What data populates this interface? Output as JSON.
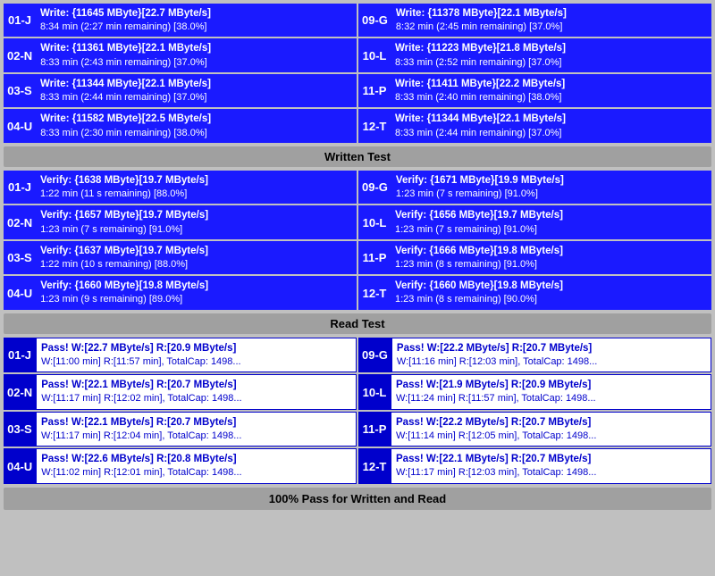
{
  "sections": {
    "write": {
      "header": "Written Test",
      "left": [
        {
          "id": "01-J",
          "line1": "Write: {11645 MByte}[22.7 MByte/s]",
          "line2": "8:34 min (2:27 min remaining)  [38.0%]"
        },
        {
          "id": "02-N",
          "line1": "Write: {11361 MByte}[22.1 MByte/s]",
          "line2": "8:33 min (2:43 min remaining)  [37.0%]"
        },
        {
          "id": "03-S",
          "line1": "Write: {11344 MByte}[22.1 MByte/s]",
          "line2": "8:33 min (2:44 min remaining)  [37.0%]"
        },
        {
          "id": "04-U",
          "line1": "Write: {11582 MByte}[22.5 MByte/s]",
          "line2": "8:33 min (2:30 min remaining)  [38.0%]"
        }
      ],
      "right": [
        {
          "id": "09-G",
          "line1": "Write: {11378 MByte}[22.1 MByte/s]",
          "line2": "8:32 min (2:45 min remaining)  [37.0%]"
        },
        {
          "id": "10-L",
          "line1": "Write: {11223 MByte}[21.8 MByte/s]",
          "line2": "8:33 min (2:52 min remaining)  [37.0%]"
        },
        {
          "id": "11-P",
          "line1": "Write: {11411 MByte}[22.2 MByte/s]",
          "line2": "8:33 min (2:40 min remaining)  [38.0%]"
        },
        {
          "id": "12-T",
          "line1": "Write: {11344 MByte}[22.1 MByte/s]",
          "line2": "8:33 min (2:44 min remaining)  [37.0%]"
        }
      ]
    },
    "verify": {
      "header": "Written Test",
      "left": [
        {
          "id": "01-J",
          "line1": "Verify: {1638 MByte}[19.7 MByte/s]",
          "line2": "1:22 min (11 s remaining)   [88.0%]"
        },
        {
          "id": "02-N",
          "line1": "Verify: {1657 MByte}[19.7 MByte/s]",
          "line2": "1:23 min (7 s remaining)   [91.0%]"
        },
        {
          "id": "03-S",
          "line1": "Verify: {1637 MByte}[19.7 MByte/s]",
          "line2": "1:22 min (10 s remaining)   [88.0%]"
        },
        {
          "id": "04-U",
          "line1": "Verify: {1660 MByte}[19.8 MByte/s]",
          "line2": "1:23 min (9 s remaining)   [89.0%]"
        }
      ],
      "right": [
        {
          "id": "09-G",
          "line1": "Verify: {1671 MByte}[19.9 MByte/s]",
          "line2": "1:23 min (7 s remaining)   [91.0%]"
        },
        {
          "id": "10-L",
          "line1": "Verify: {1656 MByte}[19.7 MByte/s]",
          "line2": "1:23 min (7 s remaining)   [91.0%]"
        },
        {
          "id": "11-P",
          "line1": "Verify: {1666 MByte}[19.8 MByte/s]",
          "line2": "1:23 min (8 s remaining)   [91.0%]"
        },
        {
          "id": "12-T",
          "line1": "Verify: {1660 MByte}[19.8 MByte/s]",
          "line2": "1:23 min (8 s remaining)   [90.0%]"
        }
      ]
    },
    "read": {
      "header": "Read Test",
      "left": [
        {
          "id": "01-J",
          "line1": "Pass! W:[22.7 MByte/s] R:[20.9 MByte/s]",
          "line2": "W:[11:00 min] R:[11:57 min], TotalCap: 1498..."
        },
        {
          "id": "02-N",
          "line1": "Pass! W:[22.1 MByte/s] R:[20.7 MByte/s]",
          "line2": "W:[11:17 min] R:[12:02 min], TotalCap: 1498..."
        },
        {
          "id": "03-S",
          "line1": "Pass! W:[22.1 MByte/s] R:[20.7 MByte/s]",
          "line2": "W:[11:17 min] R:[12:04 min], TotalCap: 1498..."
        },
        {
          "id": "04-U",
          "line1": "Pass! W:[22.6 MByte/s] R:[20.8 MByte/s]",
          "line2": "W:[11:02 min] R:[12:01 min], TotalCap: 1498..."
        }
      ],
      "right": [
        {
          "id": "09-G",
          "line1": "Pass! W:[22.2 MByte/s] R:[20.7 MByte/s]",
          "line2": "W:[11:16 min] R:[12:03 min], TotalCap: 1498..."
        },
        {
          "id": "10-L",
          "line1": "Pass! W:[21.9 MByte/s] R:[20.9 MByte/s]",
          "line2": "W:[11:24 min] R:[11:57 min], TotalCap: 1498..."
        },
        {
          "id": "11-P",
          "line1": "Pass! W:[22.2 MByte/s] R:[20.7 MByte/s]",
          "line2": "W:[11:14 min] R:[12:05 min], TotalCap: 1498..."
        },
        {
          "id": "12-T",
          "line1": "Pass! W:[22.1 MByte/s] R:[20.7 MByte/s]",
          "line2": "W:[11:17 min] R:[12:03 min], TotalCap: 1498..."
        }
      ]
    }
  },
  "headers": {
    "written_test": "Written Test",
    "read_test": "Read Test"
  },
  "footer": "100% Pass for Written and Read"
}
